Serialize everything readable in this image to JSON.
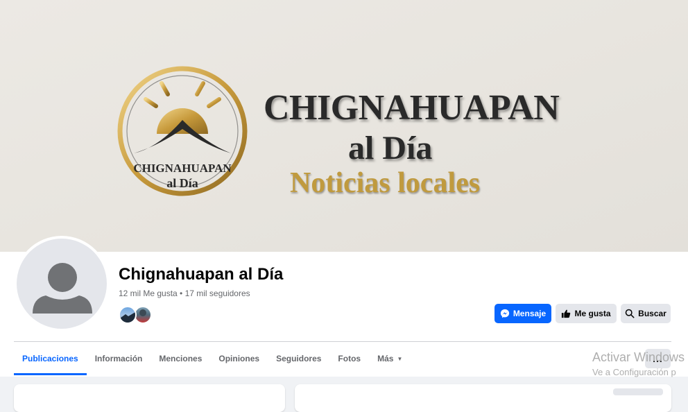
{
  "cover": {
    "logo_line1": "CHIGNAHUAPAN",
    "logo_line2": "al Día",
    "title": "CHIGNAHUAPAN",
    "subtitle": "al Día",
    "tagline": "Noticias locales"
  },
  "page": {
    "name": "Chignahuapan al Día",
    "stats": "12 mil Me gusta • 17 mil seguidores"
  },
  "actions": {
    "message": "Mensaje",
    "like": "Me gusta",
    "search": "Buscar"
  },
  "tabs": [
    {
      "label": "Publicaciones",
      "active": true
    },
    {
      "label": "Información"
    },
    {
      "label": "Menciones"
    },
    {
      "label": "Opiniones"
    },
    {
      "label": "Seguidores"
    },
    {
      "label": "Fotos"
    },
    {
      "label": "Más"
    }
  ],
  "more_button": "...",
  "watermark": {
    "line1": "Activar Windows",
    "line2": "Ve a Configuración p"
  },
  "colors": {
    "accent": "#0866ff",
    "gold": "#c09a3e",
    "secondary_button": "#e4e6eb",
    "muted_text": "#65676b"
  },
  "icons": [
    "messenger-icon",
    "thumbs-up-icon",
    "search-icon",
    "caret-down-icon",
    "default-avatar-icon",
    "gold-sun-mountain-logo"
  ]
}
